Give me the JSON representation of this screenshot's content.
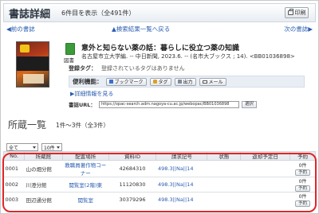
{
  "header": {
    "title": "書誌詳細",
    "count": "6件目を表示（全491件）",
    "print_label": "印刷"
  },
  "nav": {
    "prev": "◀前の書誌",
    "back": "▲検索結果一覧へ戻る",
    "next": "次の書誌▶"
  },
  "book": {
    "type_label": "図書",
    "title": "意外と知らない薬の話：暮らしに役立つ薬の知識",
    "meta": "名古屋市立大学編. -- 中日新聞, 2023.6. -- (名市大ブックス ; 14). <BB01036898>"
  },
  "tags": {
    "label": "登録タグ：",
    "value": "登録されているタグはありません"
  },
  "tools": {
    "label": "便利機能：",
    "buttons": [
      {
        "label": "ブックマーク",
        "icon": "bookmark-icon"
      },
      {
        "label": "タグ",
        "icon": "tag-icon"
      },
      {
        "label": "出力",
        "icon": "output-icon"
      },
      {
        "label": "メール",
        "icon": "mail-icon"
      }
    ]
  },
  "detail_link": "▶詳細情報を見る",
  "url": {
    "label": "書誌URL：",
    "value": "https://opac-search.adm.nagoya-cu.ac.jp/webopac/BB01036898",
    "select_label": "選択"
  },
  "holdings": {
    "title": "所蔵一覧",
    "count": "1件～3件（全3件）",
    "filter_value": "全て",
    "per_page_value": "10件",
    "columns": [
      "No.",
      "所蔵館",
      "配置場所",
      "資料ID",
      "請求記号",
      "状態",
      "返却予定日",
      "予約"
    ],
    "rows": [
      {
        "no": "0001",
        "library": "山の畑分館",
        "location": "教職員著作物コーナー",
        "id": "42684310",
        "call": "498.3||Na||14",
        "status": "",
        "due": "",
        "reserve_count": "0件",
        "reserve_btn": "予約"
      },
      {
        "no": "0002",
        "library": "川澄分館",
        "location": "閲覧室(2階)東",
        "id": "11120830",
        "call": "498.3||Na||14",
        "status": "",
        "due": "",
        "reserve_count": "0件",
        "reserve_btn": "予約"
      },
      {
        "no": "0003",
        "library": "田辺通分館",
        "location": "閲覧室",
        "id": "30379296",
        "call": "498.3||Na||14",
        "status": "",
        "due": "",
        "reserve_count": "0件",
        "reserve_btn": "予約"
      }
    ]
  },
  "colors": {
    "link": "#2a5db0",
    "highlight": "#e0252a",
    "book_icon": "#3a9b3a"
  }
}
